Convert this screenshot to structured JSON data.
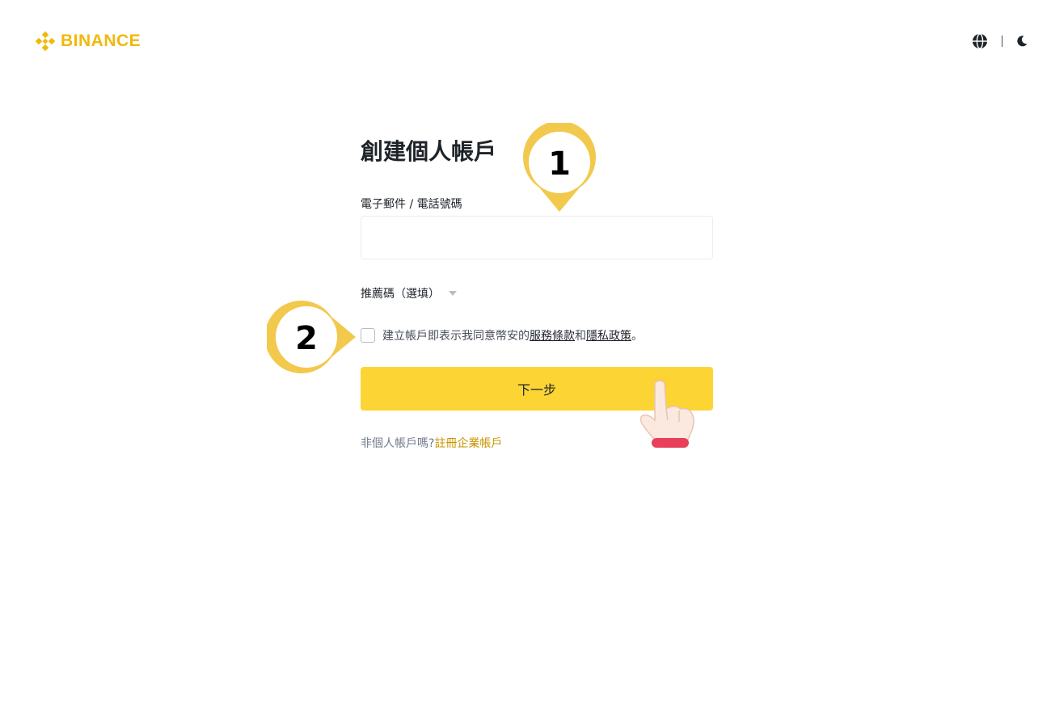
{
  "header": {
    "brand": "BINANCE",
    "icons": {
      "logo": "binance-diamond-icon",
      "language": "globe-icon",
      "theme": "moon-icon"
    },
    "accent_color": "#f0b90b"
  },
  "form": {
    "title": "創建個人帳戶",
    "email_label": "電子郵件 / 電話號碼",
    "email_value": "",
    "email_placeholder": "",
    "referral_label": "推薦碼（選填）",
    "terms_prefix": "建立帳戶即表示我同意幣安的",
    "terms_link": "服務條款",
    "terms_join": "和",
    "privacy_link": "隱私政策",
    "terms_suffix": "。",
    "next_button": "下一步",
    "business_prompt": "非個人帳戶嗎?",
    "business_link": "註冊企業帳戶",
    "button_color": "#fcd535"
  },
  "annotations": {
    "step1": "1",
    "step2": "2",
    "marker_color": "#f2c94c",
    "pointer": "pointing-hand-icon"
  }
}
